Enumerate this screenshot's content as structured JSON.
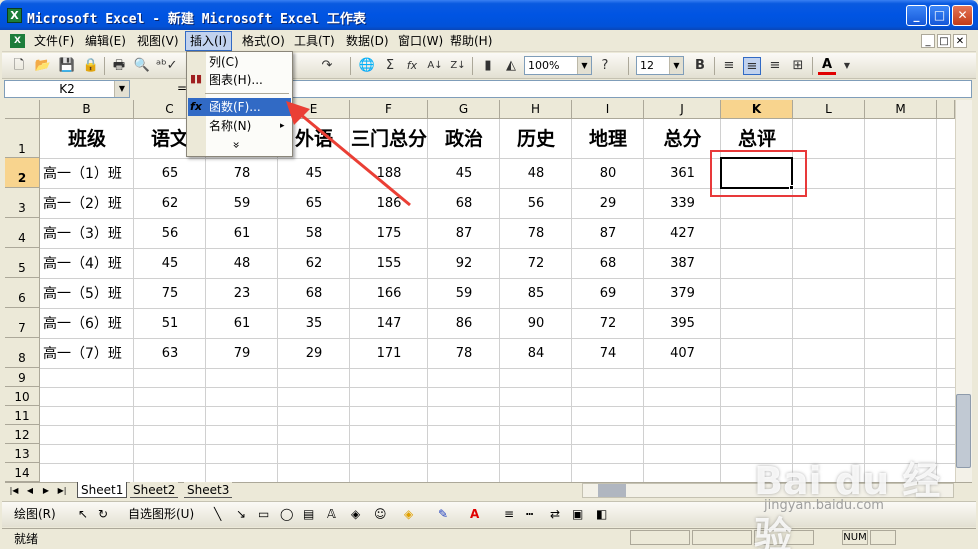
{
  "window": {
    "title": "Microsoft Excel - 新建 Microsoft Excel 工作表",
    "app_icon_letter": "X",
    "minimize_glyph": "_",
    "maximize_glyph": "□",
    "close_glyph": "✕"
  },
  "menu": {
    "items": [
      "文件(F)",
      "编辑(E)",
      "视图(V)",
      "插入(I)",
      "格式(O)",
      "工具(T)",
      "数据(D)",
      "窗口(W)",
      "帮助(H)"
    ],
    "active_index": 3
  },
  "toolbar": {
    "zoom": "100%",
    "font_size": "12",
    "bold": "B"
  },
  "formula_bar": {
    "name_box": "K2",
    "equals": "=",
    "content": ""
  },
  "dropdown": {
    "items": [
      {
        "label": "列(C)",
        "icon": ""
      },
      {
        "label": "图表(H)...",
        "icon": "chart-icon"
      },
      {
        "label": "函数(F)...",
        "icon": "fx-icon"
      },
      {
        "label": "名称(N)",
        "icon": ""
      },
      {
        "label": "»",
        "icon": ""
      }
    ],
    "highlighted_index": 2,
    "fx_glyph": "fx",
    "chart_glyph": "▮▮",
    "submenu_arrow": "▸"
  },
  "sheet": {
    "columns": [
      "B",
      "C",
      "D",
      "E",
      "F",
      "G",
      "H",
      "I",
      "J",
      "K",
      "L",
      "M"
    ],
    "selected_column": "K",
    "selected_row": 2,
    "row_numbers": [
      "1",
      "2",
      "3",
      "4",
      "5",
      "6",
      "7",
      "8",
      "9",
      "10",
      "11",
      "12",
      "13",
      "14"
    ],
    "header_row": [
      "班级",
      "语文",
      "",
      "外语",
      "三门总分",
      "政治",
      "历史",
      "地理",
      "总分",
      "总评"
    ],
    "rows": [
      [
        "高一（1）班",
        "65",
        "78",
        "45",
        "188",
        "45",
        "48",
        "80",
        "361"
      ],
      [
        "高一（2）班",
        "62",
        "59",
        "65",
        "186",
        "68",
        "56",
        "29",
        "339"
      ],
      [
        "高一（3）班",
        "56",
        "61",
        "58",
        "175",
        "87",
        "78",
        "87",
        "427"
      ],
      [
        "高一（4）班",
        "45",
        "48",
        "62",
        "155",
        "92",
        "72",
        "68",
        "387"
      ],
      [
        "高一（5）班",
        "75",
        "23",
        "68",
        "166",
        "59",
        "85",
        "69",
        "379"
      ],
      [
        "高一（6）班",
        "51",
        "61",
        "35",
        "147",
        "86",
        "90",
        "72",
        "395"
      ],
      [
        "高一（7）班",
        "63",
        "79",
        "29",
        "171",
        "78",
        "84",
        "74",
        "407"
      ]
    ]
  },
  "sheet_tabs": [
    "Sheet1",
    "Sheet2",
    "Sheet3"
  ],
  "active_sheet_index": 0,
  "drawing_toolbar": {
    "draw_label": "绘图(R)",
    "autoshape_label": "自选图形(U)"
  },
  "status": {
    "text": "就绪",
    "num": "NUM"
  },
  "watermark": {
    "logo": "Bai du 经验",
    "url": "jingyan.baidu.com"
  },
  "colors": {
    "title_bar": "#0054e3",
    "highlight_red": "#e8393a",
    "menu_highlight": "#316ac5",
    "selected_header": "#f8d48e"
  }
}
